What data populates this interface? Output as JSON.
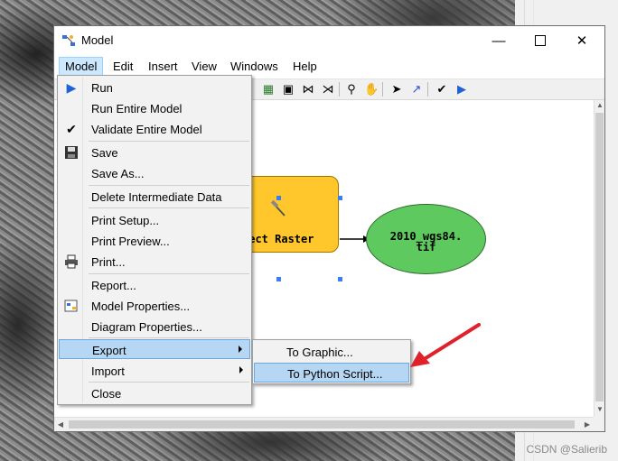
{
  "window": {
    "title": "Model",
    "icon": "model-icon"
  },
  "menubar": {
    "items": [
      "Model",
      "Edit",
      "Insert",
      "View",
      "Windows",
      "Help"
    ]
  },
  "model_menu": {
    "items": [
      {
        "label": "Run",
        "icon": "run-icon"
      },
      {
        "label": "Run Entire Model"
      },
      {
        "label": "Validate Entire Model",
        "icon": "checkmark-icon"
      },
      {
        "label": "Save",
        "icon": "save-icon"
      },
      {
        "label": "Save As..."
      },
      {
        "label": "Delete Intermediate Data"
      },
      {
        "label": "Print Setup..."
      },
      {
        "label": "Print Preview..."
      },
      {
        "label": "Print...",
        "icon": "printer-icon"
      },
      {
        "label": "Report..."
      },
      {
        "label": "Model Properties...",
        "icon": "model-properties-icon"
      },
      {
        "label": "Diagram Properties..."
      },
      {
        "label": "Export",
        "submenu": true
      },
      {
        "label": "Import",
        "submenu": true
      },
      {
        "label": "Close"
      }
    ]
  },
  "export_submenu": {
    "items": [
      "To Graphic...",
      "To Python Script..."
    ]
  },
  "diagram": {
    "tool_label": "ject Raster",
    "output_label_line1": "2010_wgs84.",
    "output_label_line2": "tif",
    "tool_color": "#ffc72c",
    "output_color": "#5ec95e"
  },
  "watermark": "CSDN @Salierib",
  "colors": {
    "highlight": "#b5d7f3",
    "annotation_arrow": "#e0202a"
  }
}
